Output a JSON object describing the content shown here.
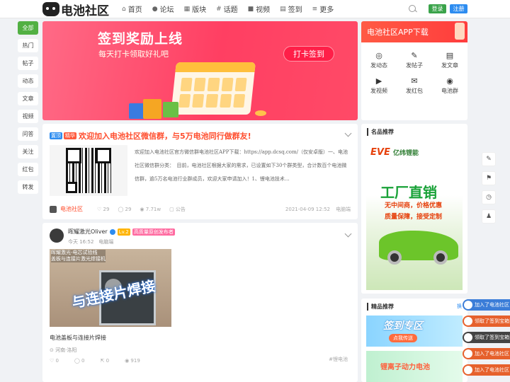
{
  "header": {
    "logo_text": "电池社区",
    "nav": [
      {
        "icon": "⌂",
        "label": "首页"
      },
      {
        "icon": "●",
        "label": "论坛"
      },
      {
        "icon": "▦",
        "label": "版块"
      },
      {
        "icon": "#",
        "label": "话题"
      },
      {
        "icon": "■",
        "label": "视频"
      },
      {
        "icon": "▤",
        "label": "签到"
      },
      {
        "icon": "≡",
        "label": "更多"
      }
    ],
    "login_label": "登录",
    "register_label": "注册"
  },
  "categories": [
    "全部",
    "热门",
    "帖子",
    "动态",
    "文章",
    "视频",
    "问答",
    "关注",
    "红包",
    "转发"
  ],
  "banner": {
    "title": "签到奖励上线",
    "subtitle": "每天打卡领取好礼吧",
    "button": "打卡签到"
  },
  "app_panel": {
    "title": "电池社区APP下载",
    "items": [
      {
        "icon": "◎",
        "label": "发动态"
      },
      {
        "icon": "✎",
        "label": "发帖子"
      },
      {
        "icon": "▤",
        "label": "发文章"
      },
      {
        "icon": "▶",
        "label": "发视频"
      },
      {
        "icon": "✉",
        "label": "发红包"
      },
      {
        "icon": "◉",
        "label": "电池群"
      }
    ]
  },
  "post1": {
    "tag1": "置顶",
    "tag2": "精华",
    "title": "欢迎加入电池社区微信群，与5万电池同行做群友!",
    "desc": "欢迎加入电池社区官方微信群电池社区APP下载：https://app.dcsq.com/（仅安卓版）一、电池社区微信群分类：　目前，电池社区根据大家的需求，已设置如下30个群类型，合计数百个电池微信群，逾5万名电池行业群成员，欢迎大家申请加入！1、锂电池技术...",
    "author": "电池社区",
    "likes": "29",
    "comments": "29",
    "views": "7.71w",
    "scope": "公告",
    "date": "2021-04-09 12:52",
    "source": "电脑端"
  },
  "post2": {
    "author": "晖耀激光Oliver",
    "level": "Lv.2",
    "badge": "高质量原创发布者",
    "time": "今天 16:52",
    "source": "电脑端",
    "img_caption1": "晖耀激光-电芯试验线",
    "img_caption2": "盖板与连接片激光焊接机",
    "img_text": "与连接片焊接",
    "title": "电池盖板与连接片焊接",
    "location": "河南·洛阳",
    "likes": "0",
    "comments": "0",
    "shares": "0",
    "views": "919",
    "topic": "#锂电池"
  },
  "recommend": {
    "title": "名品推荐",
    "ad_brand": "EVE",
    "ad_brand_cn": "亿纬锂能",
    "ad_big": "工厂直销",
    "ad_line1": "无中间商，价格优惠",
    "ad_line2": "质量保障，接受定制"
  },
  "premium": {
    "title": "精品推荐",
    "more": "换",
    "banner1_title": "签到专区",
    "banner1_sub": "点我传送",
    "banner2_title": "锂离子动力电池"
  },
  "tools": [
    "✎",
    "⚑",
    "◷",
    "♟"
  ],
  "notifications": [
    {
      "text": "加入了电池社区",
      "color": "#3b7dd8"
    },
    {
      "text": "领取了签到宝箱奖励",
      "color": "#e6612c"
    },
    {
      "text": "领取了签到宝箱奖励",
      "color": "#444444"
    },
    {
      "text": "加入了电池社区",
      "color": "#e6612c"
    },
    {
      "text": "加入了电池社区",
      "color": "#e6612c"
    }
  ]
}
